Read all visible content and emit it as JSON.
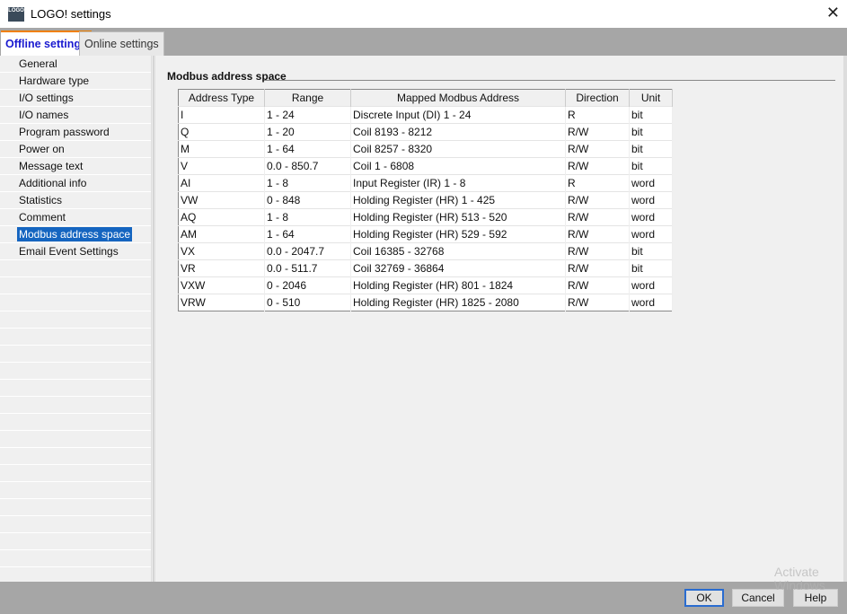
{
  "window": {
    "title": "LOGO! settings",
    "close": "✕"
  },
  "tabs": [
    {
      "label": "Offline settings",
      "active": true
    },
    {
      "label": "Online settings",
      "active": false
    }
  ],
  "sidebar": {
    "items": [
      "General",
      "Hardware type",
      "I/O settings",
      "I/O names",
      "Program password",
      "Power on",
      "Message text",
      "Additional info",
      "Statistics",
      "Comment",
      "Modbus address space",
      "Email Event Settings"
    ],
    "selected": "Modbus address space"
  },
  "main": {
    "section_title": "Modbus address space",
    "table": {
      "headers": [
        "Address Type",
        "Range",
        "Mapped Modbus Address",
        "Direction",
        "Unit"
      ],
      "rows": [
        [
          "I",
          "1 - 24",
          "Discrete Input (DI) 1 - 24",
          "R",
          "bit"
        ],
        [
          "Q",
          "1 - 20",
          "Coil 8193 - 8212",
          "R/W",
          "bit"
        ],
        [
          "M",
          "1 - 64",
          "Coil 8257 - 8320",
          "R/W",
          "bit"
        ],
        [
          "V",
          "0.0 - 850.7",
          "Coil 1 - 6808",
          "R/W",
          "bit"
        ],
        [
          "AI",
          "1 - 8",
          "Input Register (IR) 1 - 8",
          "R",
          "word"
        ],
        [
          "VW",
          "0 - 848",
          "Holding Register (HR) 1 - 425",
          "R/W",
          "word"
        ],
        [
          "AQ",
          "1 - 8",
          "Holding Register (HR) 513 - 520",
          "R/W",
          "word"
        ],
        [
          "AM",
          "1 - 64",
          "Holding Register (HR) 529 - 592",
          "R/W",
          "word"
        ],
        [
          "VX",
          "0.0 - 2047.7",
          "Coil 16385 - 32768",
          "R/W",
          "bit"
        ],
        [
          "VR",
          "0.0 - 511.7",
          "Coil 32769 - 36864",
          "R/W",
          "bit"
        ],
        [
          "VXW",
          "0 - 2046",
          "Holding Register (HR) 801 - 1824",
          "R/W",
          "word"
        ],
        [
          "VRW",
          "0 - 510",
          "Holding Register (HR) 1825 - 2080",
          "R/W",
          "word"
        ]
      ]
    }
  },
  "footer": {
    "ok": "OK",
    "cancel": "Cancel",
    "help": "Help"
  },
  "watermark": "Activate Windows"
}
